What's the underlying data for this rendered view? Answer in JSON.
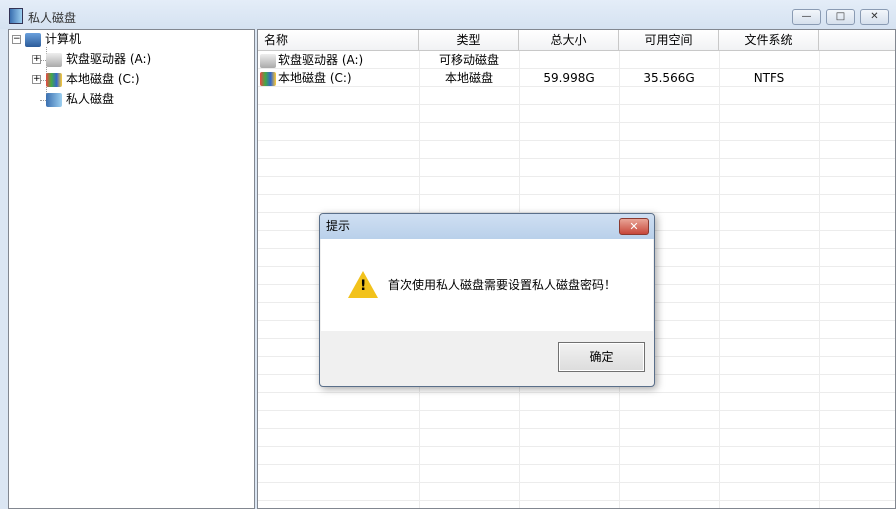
{
  "window": {
    "title": "私人磁盘"
  },
  "tree": {
    "root": "计算机",
    "children": [
      {
        "label": "软盘驱动器 (A:)"
      },
      {
        "label": "本地磁盘 (C:)"
      },
      {
        "label": "私人磁盘"
      }
    ]
  },
  "list": {
    "columns": [
      "名称",
      "类型",
      "总大小",
      "可用空间",
      "文件系统"
    ],
    "rows": [
      [
        "软盘驱动器 (A:)",
        "可移动磁盘",
        "",
        "",
        ""
      ],
      [
        "本地磁盘 (C:)",
        "本地磁盘",
        "59.998G",
        "35.566G",
        "NTFS"
      ]
    ]
  },
  "dialog": {
    "title": "提示",
    "message": "首次使用私人磁盘需要设置私人磁盘密码！",
    "ok": "确定"
  }
}
